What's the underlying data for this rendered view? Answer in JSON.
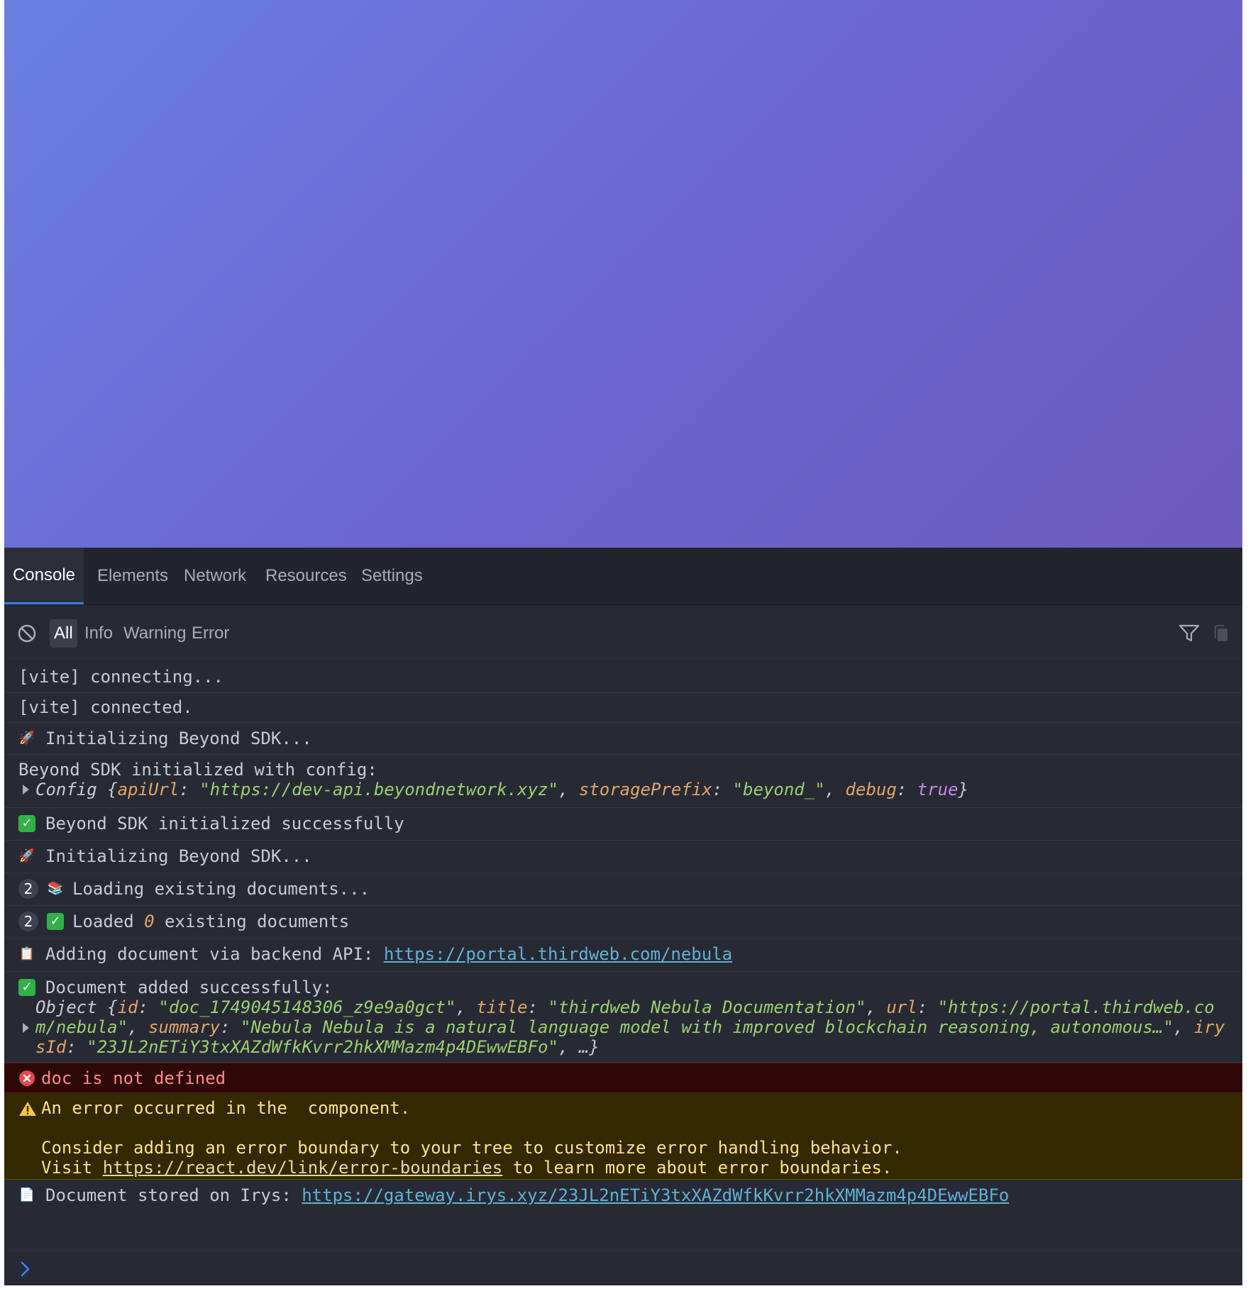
{
  "tabs": [
    "Console",
    "Elements",
    "Network",
    "Resources",
    "Settings"
  ],
  "active_tab": "Console",
  "filters": [
    "All",
    "Info",
    "Warning",
    "Error"
  ],
  "active_filter": "All",
  "logs": {
    "l1": "[vite] connecting...",
    "l2": "[vite] connected.",
    "l3": "Initializing Beyond SDK...",
    "l4_line1": "Beyond SDK initialized with config:",
    "l4_config": {
      "prefix": "Config {",
      "k1": "apiUrl",
      "v1": "\"https://dev-api.beyondnetwork.xyz\"",
      "k2": "storagePrefix",
      "v2": "\"beyond_\"",
      "k3": "debug",
      "v3": "true",
      "suffix": "}"
    },
    "l5": "Beyond SDK initialized successfully",
    "l6": "Initializing Beyond SDK...",
    "l7_count": "2",
    "l7": "Loading existing documents...",
    "l8_count": "2",
    "l8_a": "Loaded ",
    "l8_num": "0",
    "l8_b": " existing documents",
    "l9_text": "Adding document via backend API: ",
    "l9_link": "https://portal.thirdweb.com/nebula",
    "l10_line1": "Document added successfully:",
    "l10_obj": {
      "prefix": "Object {",
      "k_id": "id",
      "v_id": "\"doc_1749045148306_z9e9a0gct\"",
      "k_title": "title",
      "v_title": "\"thirdweb Nebula Documentation\"",
      "k_url": "url",
      "v_url_1": "\"https://portal.thirdweb.co",
      "v_url_2": "m/nebula\"",
      "k_summary": "summary",
      "v_summary": "\"Nebula Nebula is a natural language model with improved blockchain reasoning, autonomous…\"",
      "k_irys_1": "iry",
      "k_irys_2": "sId",
      "v_irys": "\"23JL2nETiY3txXAZdWfkKvrr2hkXMMazm4p4DEwwEBFo\"",
      "suffix": ", …}"
    },
    "error": "doc is not defined",
    "warn_line1": "An error occurred in the  component.",
    "warn_line2": "Consider adding an error boundary to your tree to customize error handling behavior.",
    "warn_line3_a": "Visit ",
    "warn_link": "https://react.dev/link/error-boundaries",
    "warn_line3_b": " to learn more about error boundaries.",
    "l11_text": "Document stored on Irys: ",
    "l11_link": "https://gateway.irys.xyz/23JL2nETiY3txXAZdWfkKvrr2hkXMMazm4p4DEwwEBFo"
  },
  "icons": {
    "clear": "clear-console-icon",
    "filter": "filter-icon",
    "copy": "copy-icon",
    "rocket": "rocket-icon",
    "books": "books-icon",
    "clipboard": "clipboard-icon",
    "document": "document-icon",
    "check": "check-icon",
    "error": "error-icon",
    "warning": "warning-icon",
    "prompt": "prompt-chevron-icon"
  },
  "colors": {
    "accent": "#3b82f6",
    "error_bg": "#2e0707",
    "warning_bg": "#332800",
    "link": "#5fb3d5"
  }
}
